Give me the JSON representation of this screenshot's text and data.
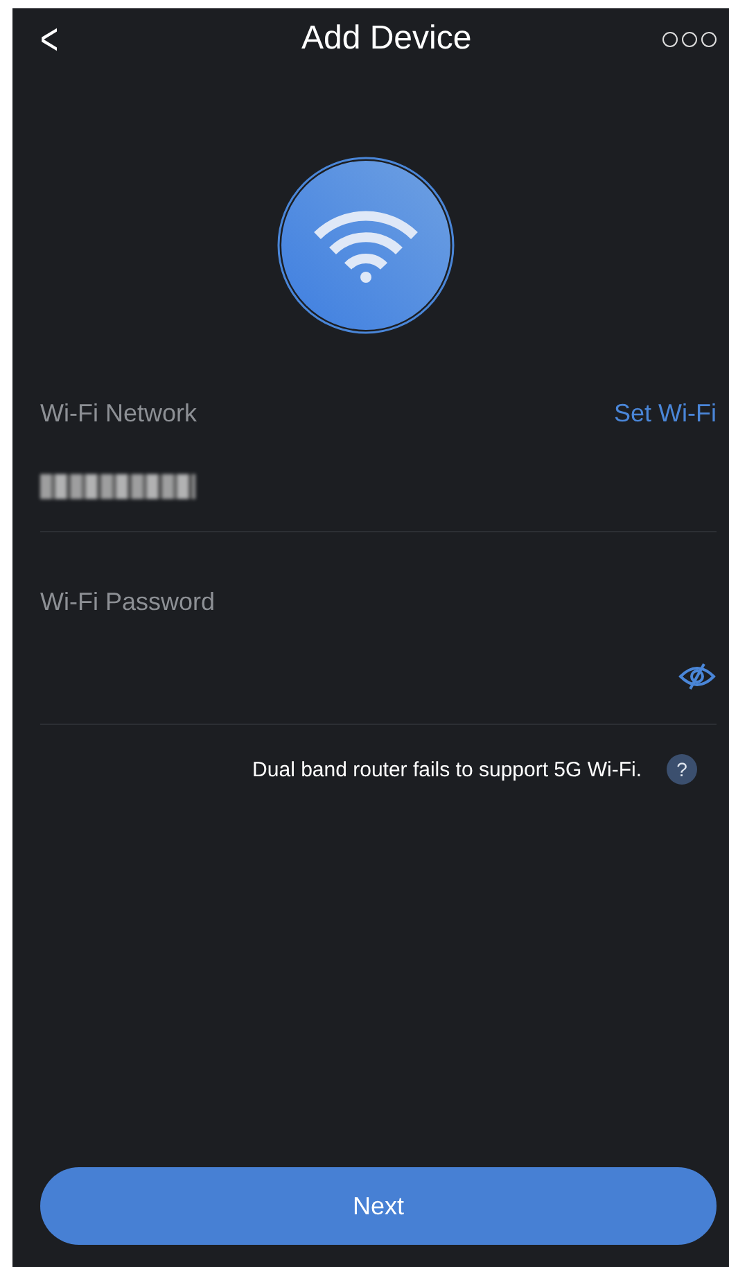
{
  "header": {
    "back": "<",
    "title": "Add Device"
  },
  "network": {
    "label": "Wi-Fi Network",
    "action": "Set Wi-Fi"
  },
  "password": {
    "label": "Wi-Fi Password"
  },
  "hint": "Dual band router fails to support 5G Wi-Fi.",
  "help": "?",
  "next_button": "Next"
}
